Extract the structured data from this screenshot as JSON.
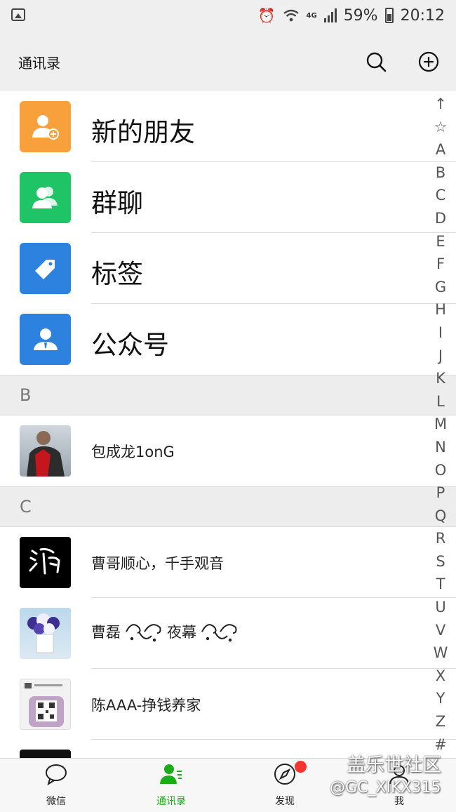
{
  "status_bar": {
    "battery": "59%",
    "time": "20:12",
    "network": "4G"
  },
  "header": {
    "title": "通讯录"
  },
  "functions": [
    {
      "label": "新的朋友",
      "color": "#f8a03b",
      "icon": "add-friend-icon"
    },
    {
      "label": "群聊",
      "color": "#1fc467",
      "icon": "group-icon"
    },
    {
      "label": "标签",
      "color": "#2d82e0",
      "icon": "tag-icon"
    },
    {
      "label": "公众号",
      "color": "#2d82e0",
      "icon": "official-account-icon"
    }
  ],
  "sections": [
    {
      "letter": "B",
      "contacts": [
        {
          "name": "包成龙1onG"
        }
      ]
    },
    {
      "letter": "C",
      "contacts": [
        {
          "name": "曹哥顺心，千手观音"
        },
        {
          "name": "曹磊"
        },
        {
          "name": "陈AAA-挣钱养家"
        }
      ]
    }
  ],
  "contact_extra": {
    "caolei_middle": "夜幕"
  },
  "index": [
    "↑",
    "☆",
    "A",
    "B",
    "C",
    "D",
    "E",
    "F",
    "G",
    "H",
    "I",
    "J",
    "K",
    "L",
    "M",
    "N",
    "O",
    "P",
    "Q",
    "R",
    "S",
    "T",
    "U",
    "V",
    "W",
    "X",
    "Y",
    "Z",
    "#"
  ],
  "tabs": [
    {
      "label": "微信",
      "icon": "chat-icon",
      "active": false
    },
    {
      "label": "通讯录",
      "icon": "contacts-icon",
      "active": true
    },
    {
      "label": "发现",
      "icon": "compass-icon",
      "active": false
    },
    {
      "label": "我",
      "icon": "me-icon",
      "active": false
    }
  ],
  "watermark": {
    "line1": "盖乐世社区",
    "line2": "@GC_XIKX315"
  },
  "accent": "#1aad19"
}
